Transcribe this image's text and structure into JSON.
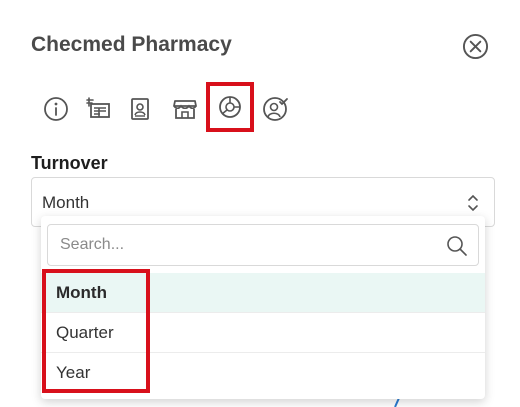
{
  "header": {
    "title": "Checmed Pharmacy"
  },
  "tabs": [
    {
      "name": "info"
    },
    {
      "name": "invoices"
    },
    {
      "name": "contact-card"
    },
    {
      "name": "store"
    },
    {
      "name": "turnover-chart",
      "active": true
    },
    {
      "name": "user-check"
    }
  ],
  "turnover": {
    "label": "Turnover",
    "selected_value": "Month"
  },
  "dropdown": {
    "search_placeholder": "Search...",
    "options": [
      {
        "label": "Month",
        "selected": true
      },
      {
        "label": "Quarter"
      },
      {
        "label": "Year"
      }
    ]
  },
  "colors": {
    "highlight": "#d8101b",
    "selected_bg": "#eaf7f4",
    "icon": "#555555"
  }
}
